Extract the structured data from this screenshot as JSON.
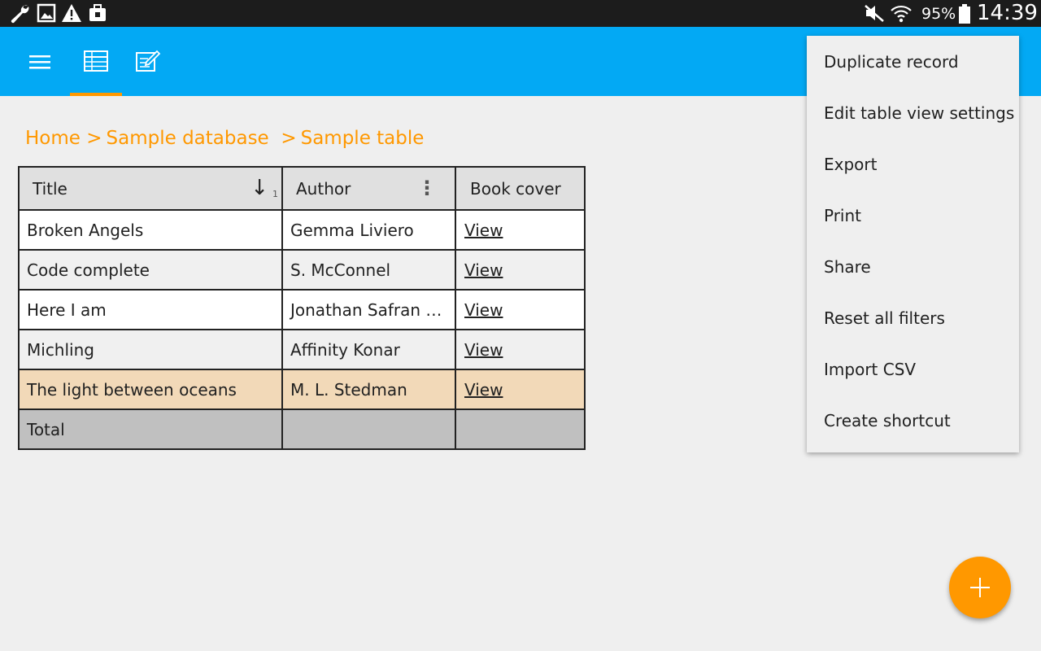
{
  "status_bar": {
    "battery": "95%",
    "time": "14:39",
    "left_icons": [
      "wrench-icon",
      "image-icon",
      "warning-icon",
      "briefcase-icon"
    ],
    "right_icons": [
      "mute-icon",
      "wifi-icon",
      "battery-icon"
    ]
  },
  "app_bar": {
    "color": "#03a9f4",
    "tabs": [
      {
        "icon": "menu-icon"
      },
      {
        "icon": "table-icon",
        "selected": true
      },
      {
        "icon": "edit-form-icon"
      }
    ],
    "indicator_color": "#ff9800"
  },
  "breadcrumb": {
    "home": "Home",
    "sep1": ">",
    "database": "Sample database",
    "sep2": ">",
    "table": "Sample table"
  },
  "table": {
    "columns": [
      "Title",
      "Author",
      "Book cover"
    ],
    "sort_index": "1",
    "rows": [
      {
        "title": "Broken Angels",
        "author": "Gemma Liviero",
        "cover": "View"
      },
      {
        "title": "Code complete",
        "author": "S. McConnel",
        "cover": "View"
      },
      {
        "title": "Here I am",
        "author": "Jonathan Safran Foer",
        "cover": "View"
      },
      {
        "title": "Michling",
        "author": "Affinity Konar",
        "cover": "View"
      },
      {
        "title": "The light between oceans",
        "author": "M. L. Stedman",
        "cover": "View"
      }
    ],
    "selected_row_index": 4,
    "selected_row_color": "#f2d9b8",
    "total_label": "Total"
  },
  "menu": {
    "items": [
      "Duplicate record",
      "Edit table view settings",
      "Export",
      "Print",
      "Share",
      "Reset all filters",
      "Import CSV",
      "Create shortcut"
    ]
  },
  "fab": {
    "icon": "plus-icon",
    "color": "#ff9800"
  }
}
